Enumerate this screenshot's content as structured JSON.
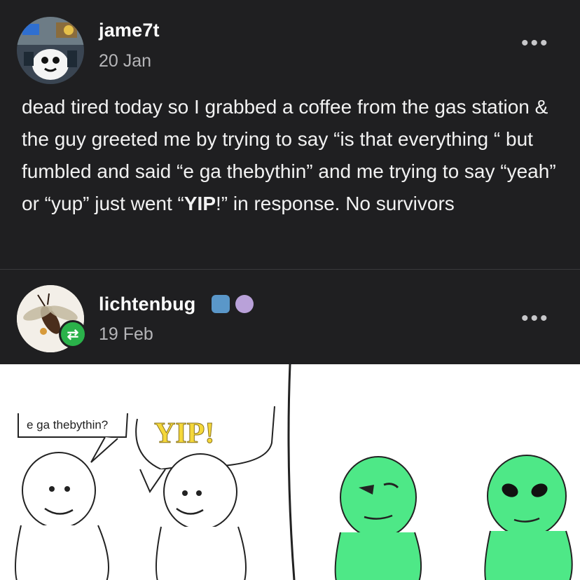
{
  "post1": {
    "username": "jame7t",
    "date": "20 Jan",
    "more": "•••",
    "text_part1": "dead tired today so I grabbed a coffee from the gas station & the guy greeted me by trying to say “is that everything “ but fumbled and said “e ga thebythin” and me trying to say “yeah” or “yup” just went “",
    "text_bold": "YIP",
    "text_part2": "!” in response. No survivors"
  },
  "post2": {
    "username": "lichtenbug",
    "date": "19 Feb",
    "more": "•••",
    "reblog_icon": "⇄"
  },
  "comic": {
    "speech1": "e ga thebythin?",
    "speech2": "YIP!"
  },
  "colors": {
    "background": "#1f1f21",
    "text": "#f2f2f2",
    "muted": "#b5b5b8",
    "reblog_green": "#2ab24a",
    "alien_green": "#4ee887",
    "yip_yellow": "#f5d83a"
  }
}
